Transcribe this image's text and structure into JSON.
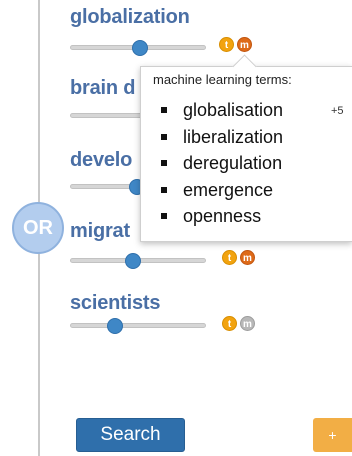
{
  "or_node": {
    "label": "OR"
  },
  "terms": [
    {
      "label": "globalization",
      "slider_value": 0.5,
      "badges": [
        "t",
        "m"
      ],
      "m_active": true
    },
    {
      "label": "brain d",
      "slider_value": 0.5,
      "badges": [],
      "m_active": true
    },
    {
      "label": "develo",
      "slider_value": 0.5,
      "badges": [],
      "m_active": true
    },
    {
      "label": "migrat",
      "slider_value": 0.45,
      "badges": [
        "t",
        "m"
      ],
      "m_active": true
    },
    {
      "label": "scientists",
      "slider_value": 0.32,
      "badges": [
        "t",
        "m"
      ],
      "m_active": false
    }
  ],
  "tooltip": {
    "title": "machine learning terms:",
    "items": [
      "globalisation",
      "liberalization",
      "deregulation",
      "emergence",
      "openness"
    ],
    "extra": "+5"
  },
  "buttons": {
    "search": "Search",
    "add": "+"
  },
  "colors": {
    "term_text": "#4a6fa5",
    "slider_knob": "#3f87c6",
    "badge_t": "#f2a30f",
    "badge_m": "#de6a18",
    "badge_m_inactive": "#b8b8b8",
    "search_button": "#2f6fab",
    "add_button": "#f2ae45",
    "or_node": "#b3cdee"
  }
}
